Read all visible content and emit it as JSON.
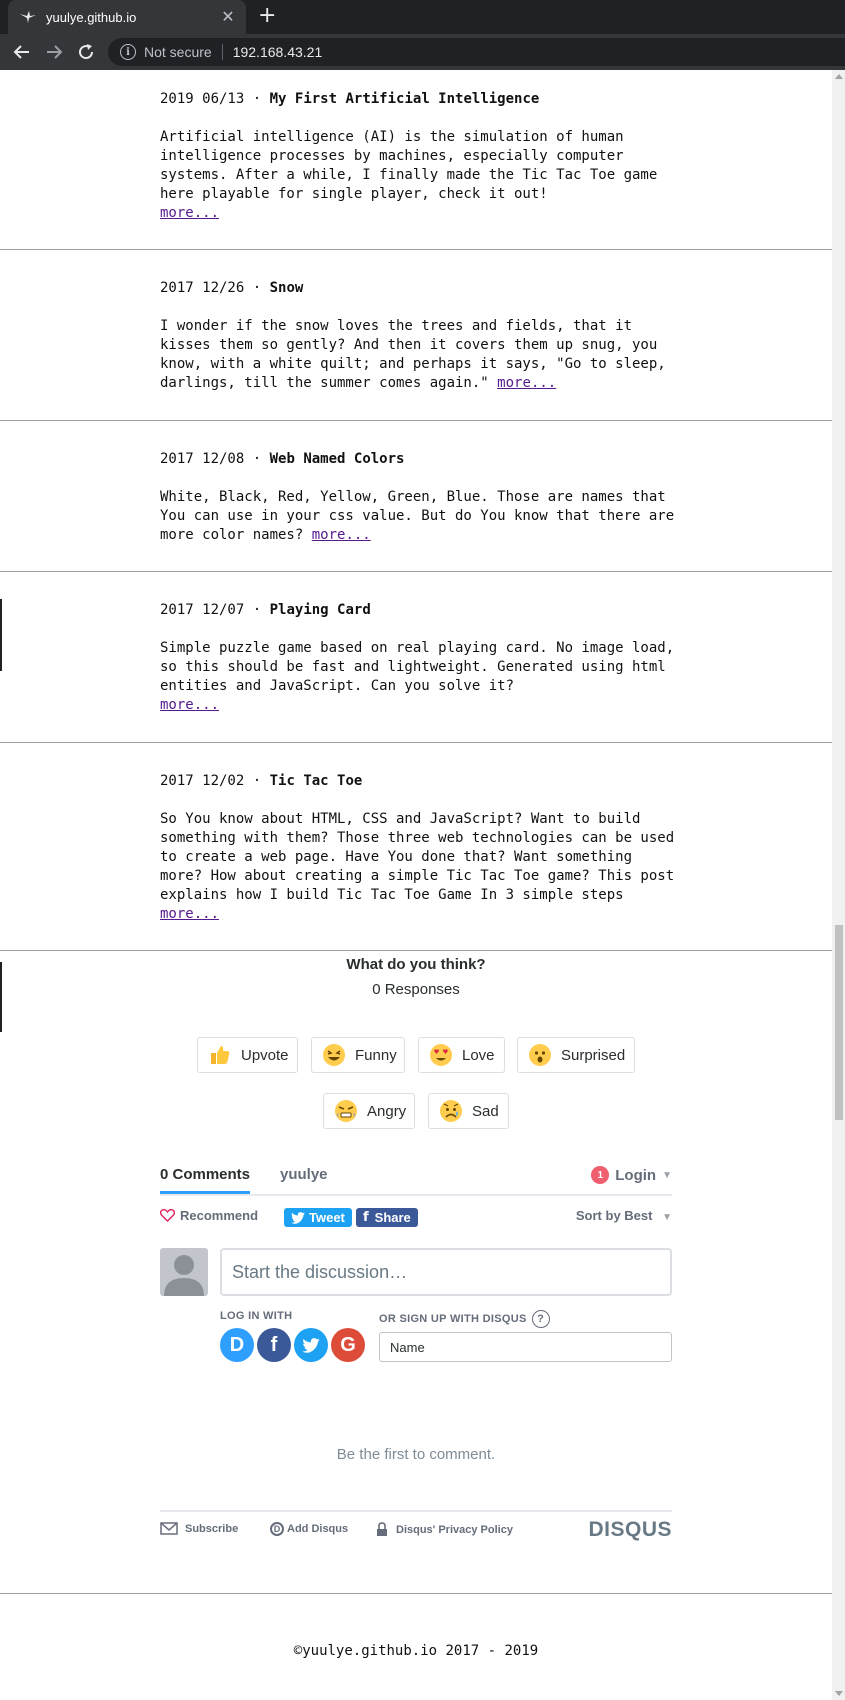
{
  "browser": {
    "tab_title": "yuulye.github.io",
    "tab_close": "✕",
    "new_tab": "+",
    "security_label": "Not secure",
    "url": "192.168.43.21"
  },
  "posts": [
    {
      "date": "2019 06/13",
      "sep": "·",
      "title": "My First Artificial Intelligence",
      "body": "Artificial intelligence (AI) is the simulation of human intelligence processes by machines, especially computer systems. After a while, I finally made the Tic Tac Toe game here playable for single player, check it out!",
      "more": "more..."
    },
    {
      "date": "2017 12/26",
      "sep": "·",
      "title": "Snow",
      "body": "I wonder if the snow loves the trees and fields, that it kisses them so gently? And then it covers them up snug, you know, with a white quilt; and perhaps it says, \"Go to sleep, darlings, till the summer comes again.\"",
      "more": "more..."
    },
    {
      "date": "2017 12/08",
      "sep": "·",
      "title": "Web Named Colors",
      "body": "White, Black, Red, Yellow, Green, Blue. Those are names that You can use in your css value. But do You know that there are more color names?",
      "more": "more..."
    },
    {
      "date": "2017 12/07",
      "sep": "·",
      "title": "Playing Card",
      "body": "Simple puzzle game based on real playing card. No image load, so this should be fast and lightweight. Generated using html entities and JavaScript. Can you solve it?",
      "more": "more..."
    },
    {
      "date": "2017 12/02",
      "sep": "·",
      "title": "Tic Tac Toe",
      "body": "So You know about HTML, CSS and JavaScript? Want to build something with them? Those three web technologies can be used to create a web page. Have You done that? Want something more? How about creating a simple Tic Tac Toe game? This post explains how I build Tic Tac Toe Game In 3 simple steps",
      "more": "more..."
    }
  ],
  "reactions": {
    "question": "What do you think?",
    "count": "0 Responses",
    "items": [
      {
        "label": "Upvote",
        "icon": "thumbs-up-icon"
      },
      {
        "label": "Funny",
        "icon": "laughing-face-icon"
      },
      {
        "label": "Love",
        "icon": "heart-eyes-face-icon"
      },
      {
        "label": "Surprised",
        "icon": "surprised-face-icon"
      },
      {
        "label": "Angry",
        "icon": "angry-face-icon"
      },
      {
        "label": "Sad",
        "icon": "sad-face-icon"
      }
    ]
  },
  "disqus": {
    "tab_comments": "0 Comments",
    "tab_site": "yuulye",
    "login_badge": "1",
    "login": "Login",
    "recommend": "Recommend",
    "tweet": "Tweet",
    "share": "Share",
    "sort": "Sort by Best",
    "discussion_placeholder": "Start the discussion…",
    "login_with": "LOG IN WITH",
    "signup": "OR SIGN UP WITH DISQUS",
    "name_placeholder": "Name",
    "first_comment": "Be the first to comment.",
    "subscribe": "Subscribe",
    "add_disqus": "Add Disqus",
    "privacy": "Disqus' Privacy Policy",
    "logo": "DISQUS"
  },
  "footer": {
    "copyright": "©yuulye.github.io 2017 - 2019"
  },
  "colors": {
    "link_visited": "#551a8b",
    "disqus_blue": "#2e9fff",
    "twitter": "#1da1f2",
    "facebook": "#3b5998",
    "google": "#dd4b39",
    "disqus_sso": "#2e9fff"
  }
}
